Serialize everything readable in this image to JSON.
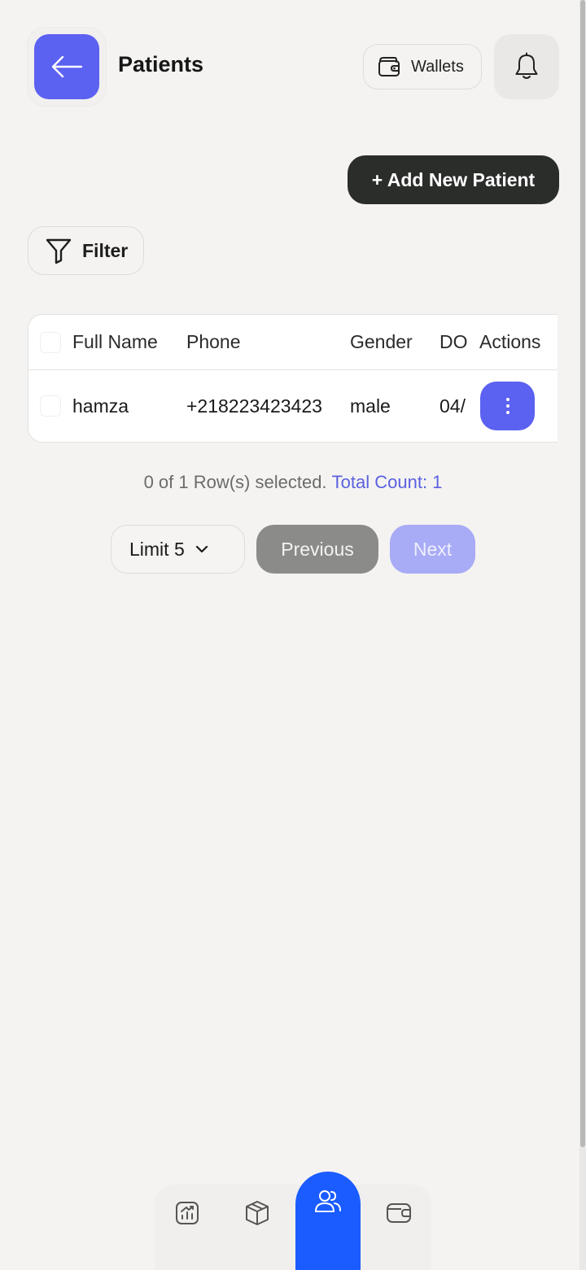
{
  "header": {
    "title": "Patients",
    "wallets_label": "Wallets"
  },
  "actions": {
    "add_patient_label": "+ Add New Patient",
    "filter_label": "Filter"
  },
  "table": {
    "columns": [
      "Full Name",
      "Phone",
      "Gender",
      "DO",
      "Actions"
    ],
    "rows": [
      {
        "full_name": "hamza",
        "phone": "+218223423423",
        "gender": "male",
        "dob": "04/"
      }
    ]
  },
  "pagination": {
    "selection_text": "0 of 1 Row(s) selected.",
    "total_count_text": "Total Count: 1",
    "limit_label": "Limit 5",
    "previous_label": "Previous",
    "next_label": "Next"
  },
  "bottom_nav": {
    "items": [
      "analytics-icon",
      "package-icon",
      "users-icon",
      "wallet-icon"
    ],
    "active": "users-icon"
  },
  "colors": {
    "accent": "#5b61f0",
    "nav_active": "#1a5cff",
    "dark_button": "#2b2d2b",
    "background": "#f4f3f1"
  }
}
